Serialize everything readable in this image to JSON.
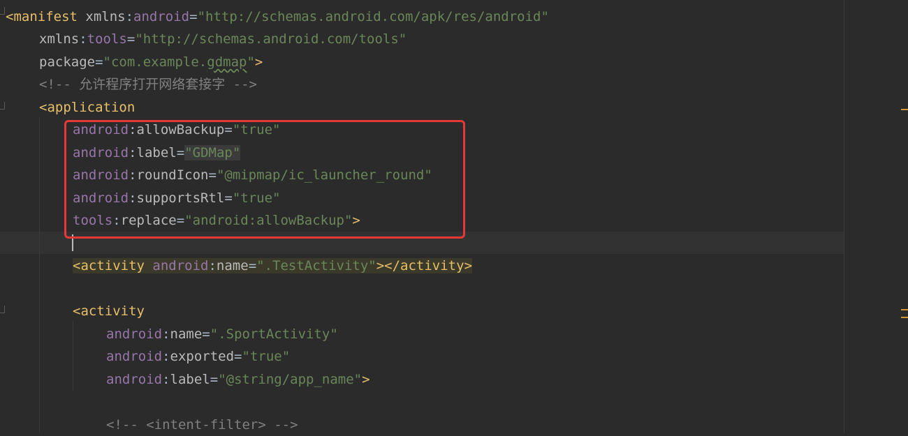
{
  "lines": {
    "l1": [
      "<manifest ",
      "xmlns",
      ":",
      "android",
      "=",
      "\"http://schemas.android.com/apk/res/android\""
    ],
    "l2": [
      "xmlns",
      ":",
      "tools",
      "=",
      "\"http://schemas.android.com/tools\""
    ],
    "l3": [
      "package",
      "=",
      "\"com.example.",
      "gdmap",
      "\"",
      ">"
    ],
    "l4": [
      "<!-- 允许程序打开网络套接字 -->"
    ],
    "l5": [
      "<application"
    ],
    "l6": [
      "android",
      ":",
      "allowBackup",
      "=",
      "\"true\""
    ],
    "l7": [
      "android",
      ":",
      "label",
      "=",
      "\"GDMap\""
    ],
    "l8": [
      "android",
      ":",
      "roundIcon",
      "=",
      "\"@mipmap/ic_launcher_round\""
    ],
    "l9": [
      "android",
      ":",
      "supportsRtl",
      "=",
      "\"true\""
    ],
    "l10": [
      "tools",
      ":",
      "replace",
      "=",
      "\"android:allowBackup\"",
      ">"
    ],
    "l12": [
      "<activity ",
      "android",
      ":",
      "name",
      "=",
      "\".TestActivity\"",
      "></activity>"
    ],
    "l14": [
      "<activity"
    ],
    "l15": [
      "android",
      ":",
      "name",
      "=",
      "\".SportActivity\""
    ],
    "l16": [
      "android",
      ":",
      "exported",
      "=",
      "\"true\""
    ],
    "l17": [
      "android",
      ":",
      "label",
      "=",
      "\"@string/app_name\"",
      ">"
    ],
    "l19": [
      "<!-- <intent-filter> -->"
    ]
  },
  "colors": {
    "background": "#2b2b2b",
    "tag": "#e8bf6a",
    "namespace": "#9876aa",
    "string": "#6a8759",
    "comment": "#808080",
    "highlight_box": "#e53935"
  }
}
